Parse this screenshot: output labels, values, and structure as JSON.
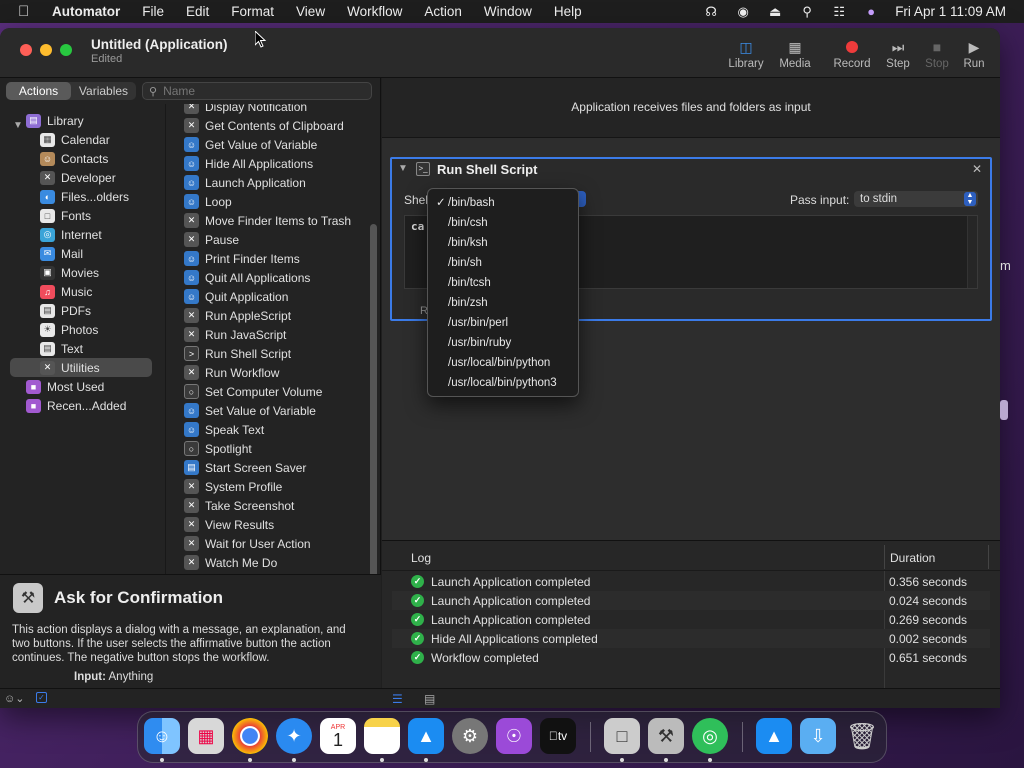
{
  "menubar": {
    "app": "Automator",
    "items": [
      "File",
      "Edit",
      "Format",
      "View",
      "Workflow",
      "Action",
      "Window",
      "Help"
    ],
    "clock": "Fri Apr 1  11:09 AM"
  },
  "window": {
    "title": "Untitled (Application)",
    "subtitle": "Edited",
    "toolbar": {
      "library": "Library",
      "media": "Media",
      "record": "Record",
      "step": "Step",
      "stop": "Stop",
      "run": "Run"
    }
  },
  "left": {
    "tabs": {
      "actions": "Actions",
      "variables": "Variables"
    },
    "search_placeholder": "Name",
    "library": [
      {
        "label": "Library",
        "color": "#8e6dd4"
      },
      {
        "label": "Calendar",
        "color": "#e8e8e8"
      },
      {
        "label": "Contacts",
        "color": "#b48a5a"
      },
      {
        "label": "Developer",
        "color": "#555555"
      },
      {
        "label": "Files...olders",
        "color": "#3a8be0"
      },
      {
        "label": "Fonts",
        "color": "#e8e8e8"
      },
      {
        "label": "Internet",
        "color": "#3aa4d8"
      },
      {
        "label": "Mail",
        "color": "#3a8be0"
      },
      {
        "label": "Movies",
        "color": "#333333"
      },
      {
        "label": "Music",
        "color": "#f04c5c"
      },
      {
        "label": "PDFs",
        "color": "#e8e8e8"
      },
      {
        "label": "Photos",
        "color": "#e8e8e8"
      },
      {
        "label": "Text",
        "color": "#e8e8e8"
      },
      {
        "label": "Utilities",
        "color": "#555555"
      },
      {
        "label": "Most Used",
        "color": "#a25ad0"
      },
      {
        "label": "Recen...Added",
        "color": "#a25ad0"
      }
    ],
    "actions": [
      "Display Notification",
      "Get Contents of Clipboard",
      "Get Value of Variable",
      "Hide All Applications",
      "Launch Application",
      "Loop",
      "Move Finder Items to Trash",
      "Pause",
      "Print Finder Items",
      "Quit All Applications",
      "Quit Application",
      "Run AppleScript",
      "Run JavaScript",
      "Run Shell Script",
      "Run Workflow",
      "Set Computer Volume",
      "Set Value of Variable",
      "Speak Text",
      "Spotlight",
      "Start Screen Saver",
      "System Profile",
      "Take Screenshot",
      "View Results",
      "Wait for User Action",
      "Watch Me Do"
    ],
    "description": {
      "title": "Ask for Confirmation",
      "text": "This action displays a dialog with a message, an explanation, and two buttons. If the user selects the affirmative button the action continues. The negative button stops the workflow.",
      "input_label": "Input:",
      "input_value": "Anything"
    }
  },
  "workflow": {
    "header": "Application receives files and folders as input",
    "action": {
      "title": "Run Shell Script",
      "shell_label": "Shel",
      "pass_label": "Pass input:",
      "pass_value": "to stdin",
      "code": "ca",
      "footer": "R"
    }
  },
  "shell_menu": {
    "items": [
      "/bin/bash",
      "/bin/csh",
      "/bin/ksh",
      "/bin/sh",
      "/bin/tcsh",
      "/bin/zsh",
      "/usr/bin/perl",
      "/usr/bin/ruby",
      "/usr/local/bin/python",
      "/usr/local/bin/python3"
    ],
    "checked": "/bin/bash"
  },
  "log": {
    "col_log": "Log",
    "col_duration": "Duration",
    "rows": [
      {
        "text": "Launch Application completed",
        "duration": "0.356 seconds"
      },
      {
        "text": "Launch Application completed",
        "duration": "0.024 seconds"
      },
      {
        "text": "Launch Application completed",
        "duration": "0.269 seconds"
      },
      {
        "text": "Hide All Applications completed",
        "duration": "0.002 seconds"
      },
      {
        "text": "Workflow completed",
        "duration": "0.651 seconds"
      }
    ]
  },
  "dock": {
    "calendar_month": "APR",
    "calendar_day": "1",
    "tv_label": "tv"
  },
  "peek_text": "m"
}
